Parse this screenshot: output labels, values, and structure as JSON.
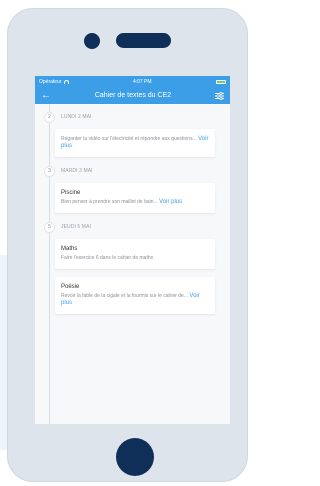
{
  "status_bar": {
    "carrier": "Opérateur",
    "time": "4:07 PM"
  },
  "header": {
    "title": "Cahier de textes du CE2"
  },
  "days": [
    {
      "number": "2",
      "label": "LUNDI 2 MAI",
      "cards": [
        {
          "title": "",
          "text": "Regarder la vidéo sur l'électricité et répondre aux questions...",
          "more": "Voir plus"
        }
      ]
    },
    {
      "number": "3",
      "label": "MARDI 3 MAI",
      "cards": [
        {
          "title": "Piscine",
          "text": "Bien penser à prendre son maillot de bain...",
          "more": "Voir plus"
        }
      ]
    },
    {
      "number": "5",
      "label": "JEUDI 5 MAI",
      "cards": [
        {
          "title": "Maths",
          "text": "Faire l'exercice 6 dans le cahier de maths",
          "more": ""
        },
        {
          "title": "Poésie",
          "text": "Revoir la fable de la cigale et la fourmis sur le cahier de...",
          "more": "Voir plus"
        }
      ]
    }
  ],
  "colors": {
    "accent": "#3d9ee8",
    "device": "#dde4ec",
    "device_dark": "#0f2f59"
  },
  "icons": {
    "back": "arrow-left-icon",
    "filter": "filter-icon",
    "wifi": "wifi-icon",
    "battery": "battery-icon"
  }
}
